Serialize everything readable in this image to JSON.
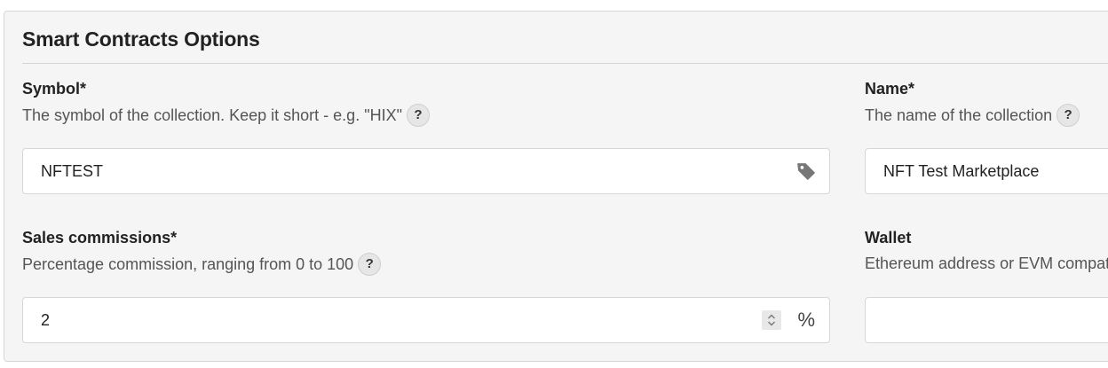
{
  "panel": {
    "title": "Smart Contracts Options"
  },
  "fields": {
    "symbol": {
      "label": "Symbol*",
      "help": "The symbol of the collection. Keep it short - e.g. \"HIX\"",
      "value": "NFTEST"
    },
    "name": {
      "label": "Name*",
      "help": "The name of the collection",
      "value": "NFT Test Marketplace"
    },
    "commission": {
      "label": "Sales commissions*",
      "help": "Percentage commission, ranging from 0 to 100",
      "value": "2",
      "unit": "%"
    },
    "wallet": {
      "label": "Wallet",
      "help": "Ethereum address or EVM compatible",
      "value": ""
    }
  },
  "help_badge": "?",
  "icons": {
    "symbol_input": "tag-icon",
    "commission_input": "spinner-icon"
  }
}
